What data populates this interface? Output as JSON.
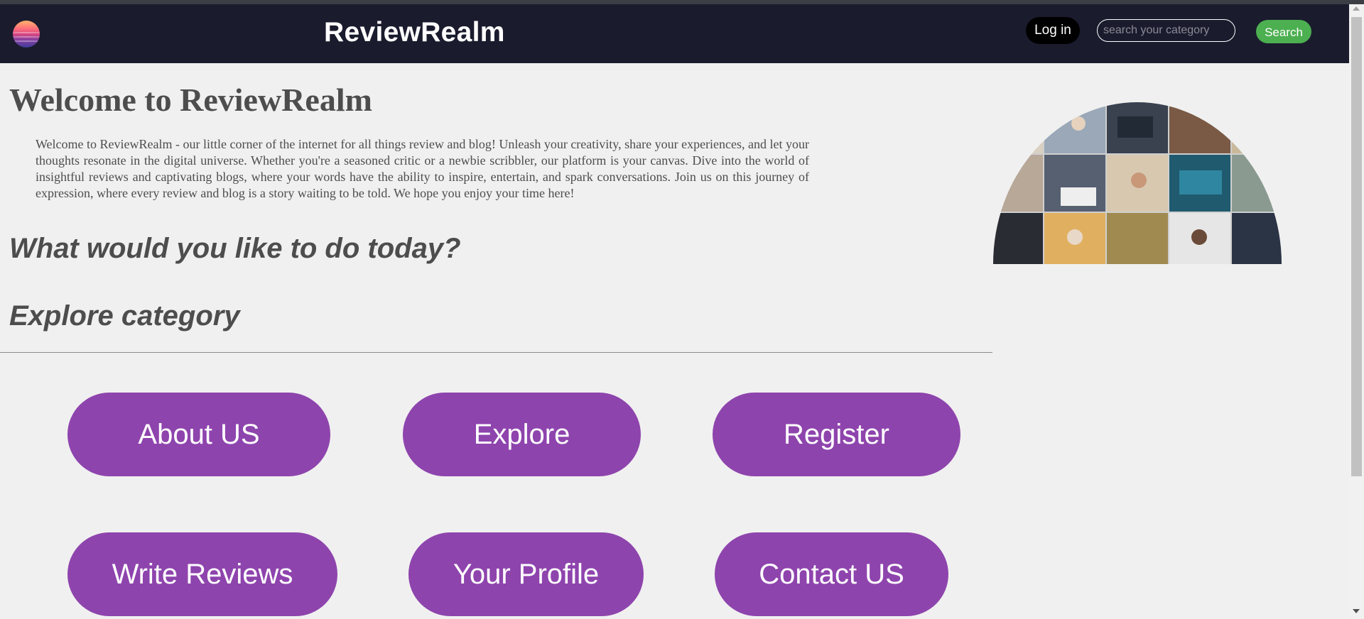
{
  "header": {
    "brand": "ReviewRealm",
    "login_label": "Log in",
    "search_placeholder": "search your category",
    "search_label": "Search"
  },
  "main": {
    "title": "Welcome to ReviewRealm",
    "intro": "Welcome to ReviewRealm - our little corner of the internet for all things review and blog! Unleash your creativity, share your experiences, and let your thoughts resonate in the digital universe. Whether you're a seasoned critic or a newbie scribbler, our platform is your canvas. Dive into the world of insightful reviews and captivating blogs, where your words have the ability to inspire, entertain, and spark conversations. Join us on this journey of expression, where every review and blog is a story waiting to be told. We hope you enjoy your time here!",
    "prompt": "What would you like to do today?",
    "explore_heading": "Explore category"
  },
  "actions": [
    {
      "label": "About US"
    },
    {
      "label": "Explore"
    },
    {
      "label": "Register"
    },
    {
      "label": "Write Reviews"
    },
    {
      "label": "Your Profile"
    },
    {
      "label": "Contact US"
    }
  ],
  "colors": {
    "navbar": "#1b1b2e",
    "accent_purple": "#8e44ad",
    "search_green": "#4caf50",
    "background": "#f0f0f0",
    "text": "#4d4d4d"
  },
  "icons": {
    "logo": "sunset-waves-logo"
  }
}
